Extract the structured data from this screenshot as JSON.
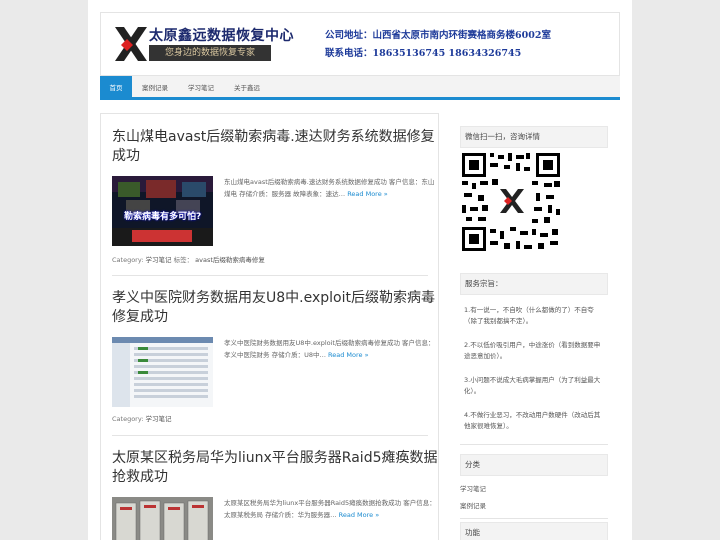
{
  "header": {
    "logo_name": "太原鑫远数据恢复中心",
    "logo_tagline": "您身边的数据恢复专家",
    "address_line": "公司地址：山西省太原市南内环街赛格商务楼6002室",
    "phone_line": "联系电话：18635136745   18634326745"
  },
  "nav": {
    "items": [
      "首页",
      "案例记录",
      "学习笔记",
      "关于鑫远"
    ]
  },
  "posts": [
    {
      "title": "东山煤电avast后缀勒索病毒.速达财务系统数据修复成功",
      "excerpt": "东山煤电avast后缀勒索病毒.速达财务系统数据修复成功 客户信息：东山煤电 存储介质：服务器 故障表象：速达… ",
      "more": "Read More »",
      "thumb_caption": "勒索病毒有多可怕?",
      "category_label": "Category:",
      "category": "学习笔记",
      "tags_label": "标签：",
      "tag": "avast后缀勒索病毒修复"
    },
    {
      "title": "孝义中医院财务数据用友U8中.exploit后缀勒索病毒修复成功",
      "excerpt": "孝义中医院财务数据用友U8中.exploit后缀勒索病毒修复成功 客户信息：孝义中医院财务 存储介质：U8中… ",
      "more": "Read More »",
      "category_label": "Category:",
      "category": "学习笔记"
    },
    {
      "title": "太原某区税务局华为liunx平台服务器Raid5瘫痪数据抢救成功",
      "excerpt": "太原某区税务局华为liunx平台服务器Raid5瘫痪数据抢救成功 客户信息：太原某税务局 存储介质：华为服务器… ",
      "more": "Read More »"
    }
  ],
  "sidebar": {
    "wechat_title": "微信扫一扫，咨询详情",
    "tenets_title": "服务宗旨：",
    "tenets": [
      "1.有一说一，不自吹（什么都做的了）不自夸（除了我别都搞不定）。",
      "2.不以低价吸引用户，中途涨价（看到数据要申途恶意加价）。",
      "3.小问题不说成大毛病掌握用户（为了利益最大化）。",
      "4.不做行业恶习，不改动用户数硬件（改动后其他家很难恢复）。"
    ],
    "categories_title": "分类",
    "categories": [
      "学习笔记",
      "案例记录"
    ],
    "functions_title": "功能"
  },
  "colors": {
    "accent": "#1b8bd0",
    "brand_navy": "#1d2a6e",
    "contact_blue": "#1e3b9a"
  }
}
